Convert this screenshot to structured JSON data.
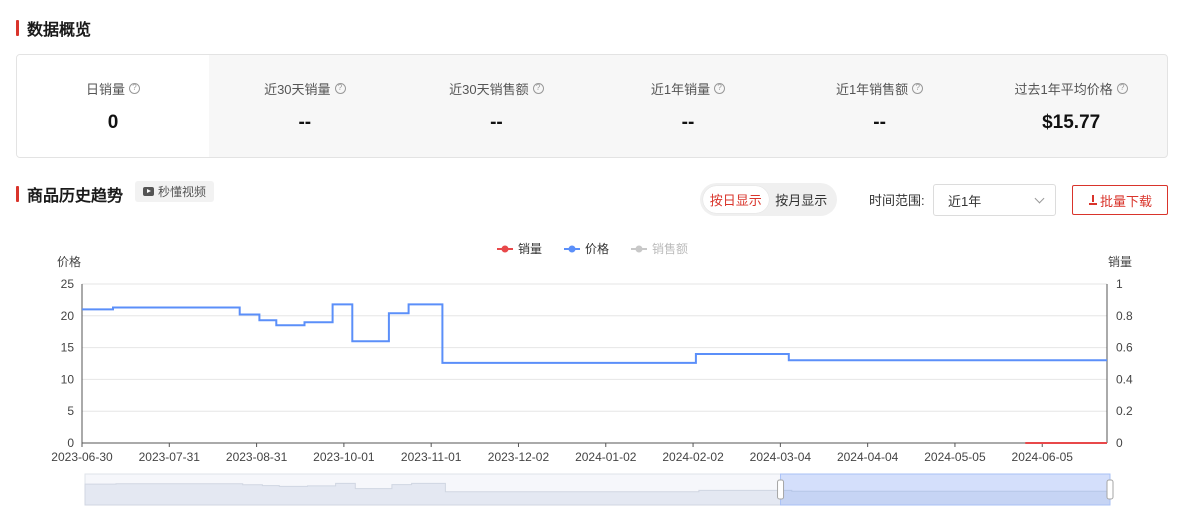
{
  "overview": {
    "title": "数据概览",
    "stats": [
      {
        "label": "日销量",
        "value": "0"
      },
      {
        "label": "近30天销量",
        "value": "--"
      },
      {
        "label": "近30天销售额",
        "value": "--"
      },
      {
        "label": "近1年销量",
        "value": "--"
      },
      {
        "label": "近1年销售额",
        "value": "--"
      },
      {
        "label": "过去1年平均价格",
        "value": "$15.77"
      }
    ]
  },
  "trend": {
    "title": "商品历史趋势",
    "video_label": "秒懂视频",
    "toggle": {
      "daily": "按日显示",
      "monthly": "按月显示",
      "selected": "daily"
    },
    "range_label": "时间范围:",
    "range_value": "近1年",
    "download_label": "批量下载"
  },
  "colors": {
    "accent": "#d9342b",
    "price": "#5b8ff9",
    "sales": "#e8484a",
    "revenue": "#c8c8c8"
  },
  "chart_data": {
    "type": "line",
    "legend": [
      "销量",
      "价格",
      "销售额"
    ],
    "legend_placement": "top-center",
    "left_axis_label": "价格",
    "right_axis_label": "销量",
    "left_ticks": [
      "25",
      "20",
      "15",
      "10",
      "5",
      "0"
    ],
    "right_ticks": [
      "1",
      "0.8",
      "0.6",
      "0.4",
      "0.2",
      "0"
    ],
    "ylim_left": [
      0,
      25
    ],
    "ylim_right": [
      0,
      1
    ],
    "xlim": [
      "2023-06-30",
      "2024-06-28"
    ],
    "x_ticks": [
      "2023-06-30",
      "2023-07-31",
      "2023-08-31",
      "2023-10-01",
      "2023-11-01",
      "2023-12-02",
      "2024-01-02",
      "2024-02-02",
      "2024-03-04",
      "2024-04-04",
      "2024-05-05",
      "2024-06-05"
    ],
    "grid": true,
    "series": [
      {
        "name": "价格",
        "axis": "left",
        "step": true,
        "points": [
          [
            "2023-06-30",
            21.0
          ],
          [
            "2023-07-11",
            21.3
          ],
          [
            "2023-08-25",
            20.2
          ],
          [
            "2023-09-01",
            19.3
          ],
          [
            "2023-09-07",
            18.5
          ],
          [
            "2023-09-17",
            19.0
          ],
          [
            "2023-09-27",
            21.8
          ],
          [
            "2023-10-04",
            16.0
          ],
          [
            "2023-10-17",
            20.4
          ],
          [
            "2023-10-24",
            21.8
          ],
          [
            "2023-11-05",
            12.6
          ],
          [
            "2024-02-03",
            14.0
          ],
          [
            "2024-03-07",
            13.0
          ],
          [
            "2024-06-28",
            13.0
          ]
        ]
      },
      {
        "name": "销量",
        "axis": "right",
        "step": false,
        "points": [
          [
            "2024-05-30",
            0
          ],
          [
            "2024-06-28",
            0
          ]
        ]
      },
      {
        "name": "销售额",
        "axis": "right",
        "step": false,
        "points": []
      }
    ],
    "zoom_range": [
      "2024-03-03",
      "2024-06-28"
    ]
  }
}
